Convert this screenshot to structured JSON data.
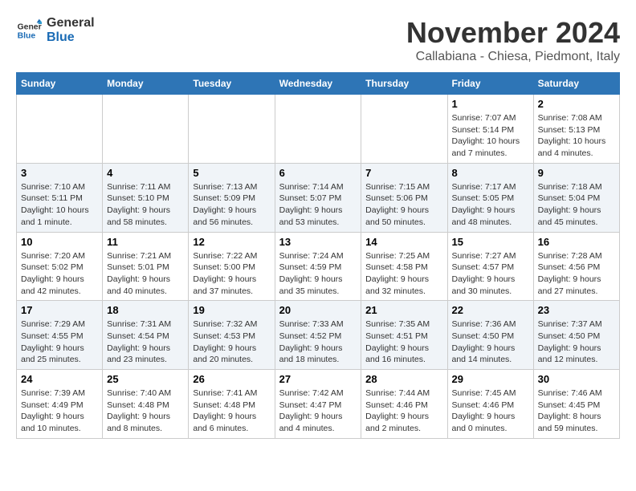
{
  "logo": {
    "line1": "General",
    "line2": "Blue"
  },
  "title": "November 2024",
  "subtitle": "Callabiana - Chiesa, Piedmont, Italy",
  "weekdays": [
    "Sunday",
    "Monday",
    "Tuesday",
    "Wednesday",
    "Thursday",
    "Friday",
    "Saturday"
  ],
  "weeks": [
    [
      {
        "day": "",
        "info": ""
      },
      {
        "day": "",
        "info": ""
      },
      {
        "day": "",
        "info": ""
      },
      {
        "day": "",
        "info": ""
      },
      {
        "day": "",
        "info": ""
      },
      {
        "day": "1",
        "info": "Sunrise: 7:07 AM\nSunset: 5:14 PM\nDaylight: 10 hours and 7 minutes."
      },
      {
        "day": "2",
        "info": "Sunrise: 7:08 AM\nSunset: 5:13 PM\nDaylight: 10 hours and 4 minutes."
      }
    ],
    [
      {
        "day": "3",
        "info": "Sunrise: 7:10 AM\nSunset: 5:11 PM\nDaylight: 10 hours and 1 minute."
      },
      {
        "day": "4",
        "info": "Sunrise: 7:11 AM\nSunset: 5:10 PM\nDaylight: 9 hours and 58 minutes."
      },
      {
        "day": "5",
        "info": "Sunrise: 7:13 AM\nSunset: 5:09 PM\nDaylight: 9 hours and 56 minutes."
      },
      {
        "day": "6",
        "info": "Sunrise: 7:14 AM\nSunset: 5:07 PM\nDaylight: 9 hours and 53 minutes."
      },
      {
        "day": "7",
        "info": "Sunrise: 7:15 AM\nSunset: 5:06 PM\nDaylight: 9 hours and 50 minutes."
      },
      {
        "day": "8",
        "info": "Sunrise: 7:17 AM\nSunset: 5:05 PM\nDaylight: 9 hours and 48 minutes."
      },
      {
        "day": "9",
        "info": "Sunrise: 7:18 AM\nSunset: 5:04 PM\nDaylight: 9 hours and 45 minutes."
      }
    ],
    [
      {
        "day": "10",
        "info": "Sunrise: 7:20 AM\nSunset: 5:02 PM\nDaylight: 9 hours and 42 minutes."
      },
      {
        "day": "11",
        "info": "Sunrise: 7:21 AM\nSunset: 5:01 PM\nDaylight: 9 hours and 40 minutes."
      },
      {
        "day": "12",
        "info": "Sunrise: 7:22 AM\nSunset: 5:00 PM\nDaylight: 9 hours and 37 minutes."
      },
      {
        "day": "13",
        "info": "Sunrise: 7:24 AM\nSunset: 4:59 PM\nDaylight: 9 hours and 35 minutes."
      },
      {
        "day": "14",
        "info": "Sunrise: 7:25 AM\nSunset: 4:58 PM\nDaylight: 9 hours and 32 minutes."
      },
      {
        "day": "15",
        "info": "Sunrise: 7:27 AM\nSunset: 4:57 PM\nDaylight: 9 hours and 30 minutes."
      },
      {
        "day": "16",
        "info": "Sunrise: 7:28 AM\nSunset: 4:56 PM\nDaylight: 9 hours and 27 minutes."
      }
    ],
    [
      {
        "day": "17",
        "info": "Sunrise: 7:29 AM\nSunset: 4:55 PM\nDaylight: 9 hours and 25 minutes."
      },
      {
        "day": "18",
        "info": "Sunrise: 7:31 AM\nSunset: 4:54 PM\nDaylight: 9 hours and 23 minutes."
      },
      {
        "day": "19",
        "info": "Sunrise: 7:32 AM\nSunset: 4:53 PM\nDaylight: 9 hours and 20 minutes."
      },
      {
        "day": "20",
        "info": "Sunrise: 7:33 AM\nSunset: 4:52 PM\nDaylight: 9 hours and 18 minutes."
      },
      {
        "day": "21",
        "info": "Sunrise: 7:35 AM\nSunset: 4:51 PM\nDaylight: 9 hours and 16 minutes."
      },
      {
        "day": "22",
        "info": "Sunrise: 7:36 AM\nSunset: 4:50 PM\nDaylight: 9 hours and 14 minutes."
      },
      {
        "day": "23",
        "info": "Sunrise: 7:37 AM\nSunset: 4:50 PM\nDaylight: 9 hours and 12 minutes."
      }
    ],
    [
      {
        "day": "24",
        "info": "Sunrise: 7:39 AM\nSunset: 4:49 PM\nDaylight: 9 hours and 10 minutes."
      },
      {
        "day": "25",
        "info": "Sunrise: 7:40 AM\nSunset: 4:48 PM\nDaylight: 9 hours and 8 minutes."
      },
      {
        "day": "26",
        "info": "Sunrise: 7:41 AM\nSunset: 4:48 PM\nDaylight: 9 hours and 6 minutes."
      },
      {
        "day": "27",
        "info": "Sunrise: 7:42 AM\nSunset: 4:47 PM\nDaylight: 9 hours and 4 minutes."
      },
      {
        "day": "28",
        "info": "Sunrise: 7:44 AM\nSunset: 4:46 PM\nDaylight: 9 hours and 2 minutes."
      },
      {
        "day": "29",
        "info": "Sunrise: 7:45 AM\nSunset: 4:46 PM\nDaylight: 9 hours and 0 minutes."
      },
      {
        "day": "30",
        "info": "Sunrise: 7:46 AM\nSunset: 4:45 PM\nDaylight: 8 hours and 59 minutes."
      }
    ]
  ]
}
